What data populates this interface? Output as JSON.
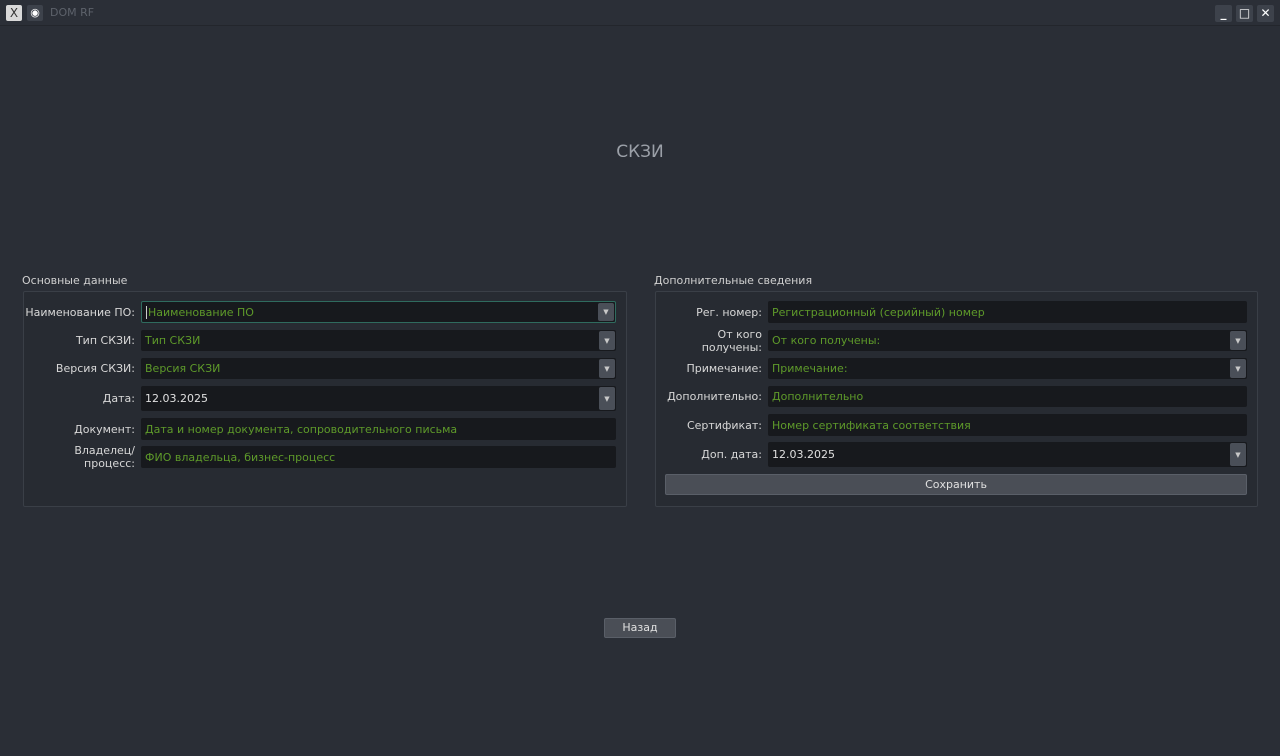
{
  "window": {
    "title": "DOM RF",
    "minimize": "_",
    "maximize": "□",
    "close": "✕"
  },
  "heading": "СКЗИ",
  "left_group": {
    "title": "Основные данные",
    "rows": [
      {
        "label": "Наименование ПО:",
        "value": "Наименование ПО",
        "type": "combo",
        "placeholder": true
      },
      {
        "label": "Тип СКЗИ:",
        "value": "Тип СКЗИ",
        "type": "combo",
        "placeholder": true
      },
      {
        "label": "Версия СКЗИ:",
        "value": "Версия СКЗИ",
        "type": "combo",
        "placeholder": true
      },
      {
        "label": "Дата:",
        "value": "12.03.2025",
        "type": "date",
        "placeholder": false
      },
      {
        "label": "Документ:",
        "value": "Дата и номер документа, сопроводительного письма",
        "type": "text",
        "placeholder": true
      },
      {
        "label": "Владелец/процесс:",
        "value": "ФИО владельца, бизнес-процесс",
        "type": "text",
        "placeholder": true
      }
    ]
  },
  "right_group": {
    "title": "Дополнительные сведения",
    "rows": [
      {
        "label": "Рег. номер:",
        "value": "Регистрационный (серийный) номер",
        "type": "text"
      },
      {
        "label": "От кого получены:",
        "value": "От кого получены:",
        "type": "combo"
      },
      {
        "label": "Примечание:",
        "value": "Примечание:",
        "type": "combo"
      },
      {
        "label": "Дополнительно:",
        "value": "Дополнительно",
        "type": "text"
      },
      {
        "label": "Сертификат:",
        "value": "Номер сертификата соответствия",
        "type": "text"
      },
      {
        "label": "Доп. дата:",
        "value": "12.03.2025",
        "type": "date"
      }
    ],
    "save_label": "Сохранить"
  },
  "back_label": "Назад"
}
